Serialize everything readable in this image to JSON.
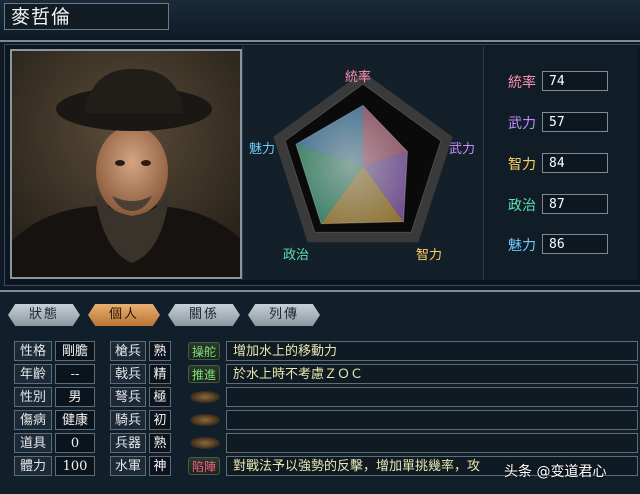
{
  "officer": {
    "name": "麥哲倫"
  },
  "radar": {
    "axis_labels": [
      "統率",
      "武力",
      "智力",
      "政治",
      "魅力"
    ],
    "values": [
      74,
      57,
      84,
      87,
      86
    ],
    "max": 100
  },
  "stats": [
    {
      "label": "統率",
      "value": "74",
      "color": "#ff8fb0"
    },
    {
      "label": "武力",
      "value": "57",
      "color": "#c68cff"
    },
    {
      "label": "智力",
      "value": "84",
      "color": "#ffd060"
    },
    {
      "label": "政治",
      "value": "87",
      "color": "#5fe0b0"
    },
    {
      "label": "魅力",
      "value": "86",
      "color": "#6fc8ff"
    }
  ],
  "tabs": [
    "狀態",
    "個人",
    "關係",
    "列傳"
  ],
  "active_tab": "個人",
  "personal": [
    {
      "label": "性格",
      "value": "剛膽"
    },
    {
      "label": "年齡",
      "value": "--"
    },
    {
      "label": "性別",
      "value": "男"
    },
    {
      "label": "傷病",
      "value": "健康"
    },
    {
      "label": "道具",
      "value": "0"
    },
    {
      "label": "體力",
      "value": "100"
    }
  ],
  "troops": [
    {
      "label": "槍兵",
      "value": "熟"
    },
    {
      "label": "戟兵",
      "value": "精"
    },
    {
      "label": "弩兵",
      "value": "極"
    },
    {
      "label": "騎兵",
      "value": "初"
    },
    {
      "label": "兵器",
      "value": "熟"
    },
    {
      "label": "水軍",
      "value": "神"
    }
  ],
  "skills": [
    {
      "name": "操舵",
      "desc": "增加水上的移動力",
      "color": "#7fe07a"
    },
    {
      "name": "推進",
      "desc": "於水上時不考慮ＺＯＣ",
      "color": "#7fe07a"
    },
    {
      "name": "",
      "desc": ""
    },
    {
      "name": "",
      "desc": ""
    },
    {
      "name": "",
      "desc": ""
    },
    {
      "name": "陷陣",
      "desc": "對戰法予以強勢的反擊，增加單挑幾率，攻",
      "color": "#ff5a8a"
    }
  ],
  "watermark": "头条 @变道君心",
  "colors": {
    "accent_tab": "#d89550",
    "panel": "#0e1b26"
  }
}
